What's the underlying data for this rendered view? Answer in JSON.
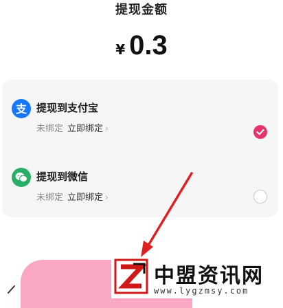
{
  "header": {
    "title": "提现金额"
  },
  "amount": {
    "currency": "¥",
    "value": "0.3"
  },
  "options": [
    {
      "label": "提现到支付宝",
      "status": "未绑定",
      "action": "立即绑定",
      "chevron": "›",
      "icon": "alipay-icon",
      "selected": true,
      "icon_color": "#1677ff"
    },
    {
      "label": "提现到微信",
      "status": "未绑定",
      "action": "立即绑定",
      "chevron": "›",
      "icon": "wechat-icon",
      "selected": false,
      "icon_color": "#2aae67"
    }
  ],
  "colors": {
    "accent": "#e7336b",
    "button": "#f9a7c3",
    "arrow": "#e02020"
  },
  "watermark": {
    "title": "中盟资讯网",
    "url": "www.lygzmsy.com"
  }
}
